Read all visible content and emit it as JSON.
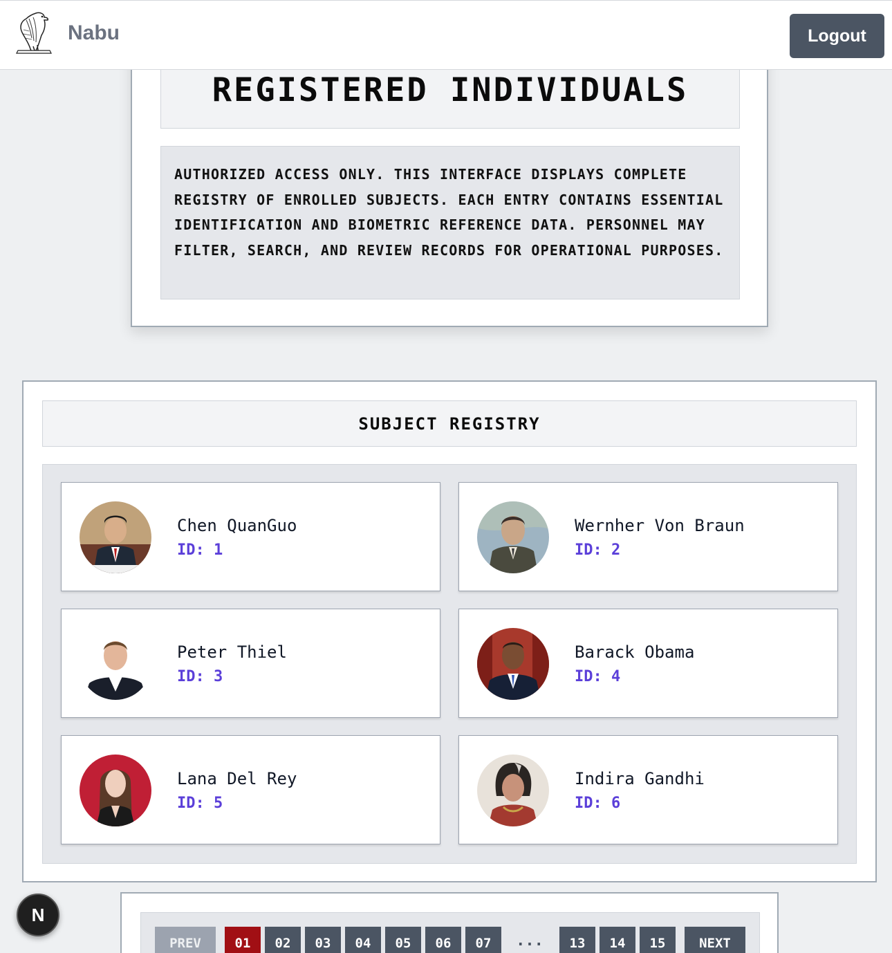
{
  "navbar": {
    "brand": "Nabu",
    "logo_icon": "falcon-logo-icon",
    "logout_label": "Logout"
  },
  "header": {
    "title": "REGISTERED INDIVIDUALS",
    "notice": "AUTHORIZED ACCESS ONLY. THIS INTERFACE DISPLAYS COMPLETE REGISTRY OF ENROLLED SUBJECTS. EACH ENTRY CONTAINS ESSENTIAL IDENTIFICATION AND BIOMETRIC REFERENCE DATA. PERSONNEL MAY FILTER, SEARCH, AND REVIEW RECORDS FOR OPERATIONAL PURPOSES."
  },
  "registry": {
    "title": "SUBJECT REGISTRY",
    "subjects": [
      {
        "name": "Chen QuanGuo",
        "id_label": "ID: 1",
        "avatar_bg": "#c0a27a",
        "avatar_fg": "#1f2937",
        "avatar_skin": "#d8ae8a"
      },
      {
        "name": "Wernher Von Braun",
        "id_label": "ID: 2",
        "avatar_bg": "#9eb4c2",
        "avatar_fg": "#4a4a3e",
        "avatar_skin": "#c9a688"
      },
      {
        "name": "Peter Thiel",
        "id_label": "ID: 3",
        "avatar_bg": "#ffffff",
        "avatar_fg": "#1a1f2b",
        "avatar_skin": "#e3b69a"
      },
      {
        "name": "Barack Obama",
        "id_label": "ID: 4",
        "avatar_bg": "#a8392c",
        "avatar_fg": "#162036",
        "avatar_skin": "#7a4d33"
      },
      {
        "name": "Lana Del Rey",
        "id_label": "ID: 5",
        "avatar_bg": "#c01f35",
        "avatar_fg": "#1a1a1a",
        "avatar_skin": "#efcfbd"
      },
      {
        "name": "Indira Gandhi",
        "id_label": "ID: 6",
        "avatar_bg": "#e8e2da",
        "avatar_fg": "#a33a30",
        "avatar_skin": "#c7927a"
      }
    ]
  },
  "pagination": {
    "prev_label": "PREV",
    "next_label": "NEXT",
    "ellipsis": "...",
    "pages_first": [
      "01",
      "02",
      "03",
      "04",
      "05",
      "06",
      "07"
    ],
    "pages_last": [
      "13",
      "14",
      "15"
    ],
    "active_page": "01"
  },
  "badge": {
    "label": "N",
    "icon": "nextjs-badge-icon"
  }
}
